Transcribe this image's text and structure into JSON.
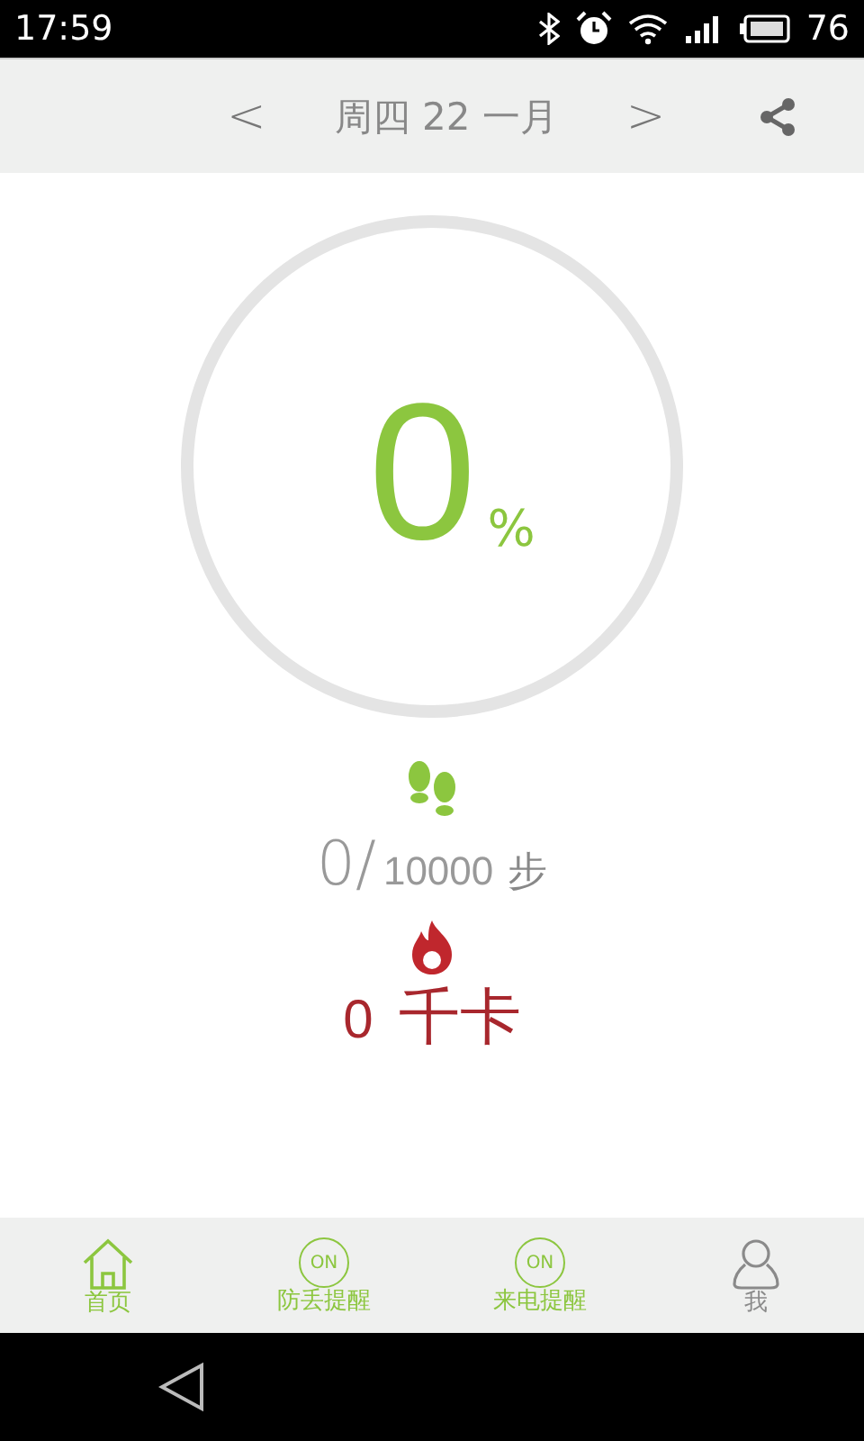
{
  "status_bar": {
    "time": "17:59",
    "battery": "76"
  },
  "header": {
    "prev": "<",
    "date": "周四 22 一月",
    "next": ">"
  },
  "progress": {
    "value": "0",
    "unit": "%",
    "level": 0
  },
  "steps": {
    "count": "0/",
    "goal": "10000",
    "unit": "步"
  },
  "calories": {
    "value": "0",
    "unit": "千卡"
  },
  "tabs": [
    {
      "kind": "home",
      "label": "首页",
      "selected": true
    },
    {
      "kind": "toggle",
      "label": "防丢提醒",
      "badge": "ON",
      "on": true
    },
    {
      "kind": "toggle",
      "label": "来电提醒",
      "badge": "ON",
      "on": true
    },
    {
      "kind": "profile",
      "label": "我",
      "selected": false
    }
  ]
}
